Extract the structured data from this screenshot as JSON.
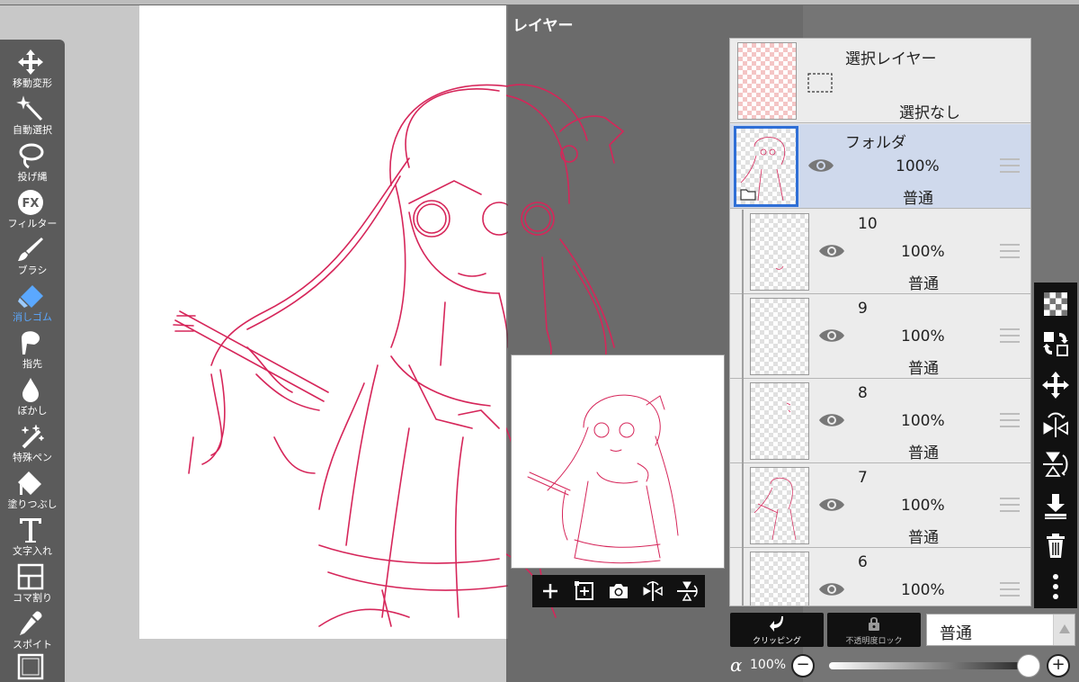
{
  "panel_title": "レイヤー",
  "toolbar": {
    "items": [
      {
        "label": "移動変形",
        "icon": "move-arrows-icon"
      },
      {
        "label": "自動選択",
        "icon": "magic-wand-icon"
      },
      {
        "label": "投げ縄",
        "icon": "lasso-icon"
      },
      {
        "label": "フィルター",
        "icon": "fx-icon"
      },
      {
        "label": "ブラシ",
        "icon": "brush-icon"
      },
      {
        "label": "消しゴム",
        "icon": "eraser-icon"
      },
      {
        "label": "指先",
        "icon": "finger-icon"
      },
      {
        "label": "ぼかし",
        "icon": "drop-icon"
      },
      {
        "label": "特殊ペン",
        "icon": "special-pen-icon"
      },
      {
        "label": "塗りつぶし",
        "icon": "bucket-icon"
      },
      {
        "label": "文字入れ",
        "icon": "text-icon"
      },
      {
        "label": "コマ割り",
        "icon": "panel-frame-icon"
      },
      {
        "label": "スポイト",
        "icon": "eyedropper-icon"
      }
    ],
    "active": "消しゴム",
    "active_color": "#5ba8ff"
  },
  "layers": {
    "selection_layer": {
      "title": "選択レイヤー",
      "status": "選択なし"
    },
    "items": [
      {
        "name": "フォルダ",
        "opacity": "100%",
        "mode": "普通",
        "selected": true
      },
      {
        "name": "10",
        "opacity": "100%",
        "mode": "普通"
      },
      {
        "name": "9",
        "opacity": "100%",
        "mode": "普通"
      },
      {
        "name": "8",
        "opacity": "100%",
        "mode": "普通"
      },
      {
        "name": "7",
        "opacity": "100%",
        "mode": "普通"
      },
      {
        "name": "6",
        "opacity": "100%",
        "mode": ""
      }
    ]
  },
  "bottom": {
    "clipping_label": "クリッピング",
    "lock_label": "不透明度ロック",
    "blend_mode": "普通",
    "alpha_symbol": "α",
    "alpha_value": "100%",
    "minus": "−",
    "plus": "+",
    "slider_value": 1.0
  },
  "colors": {
    "sketch": "#d6265a",
    "selected_row": "#cfd9ec",
    "selected_border": "#2f6fd6"
  }
}
